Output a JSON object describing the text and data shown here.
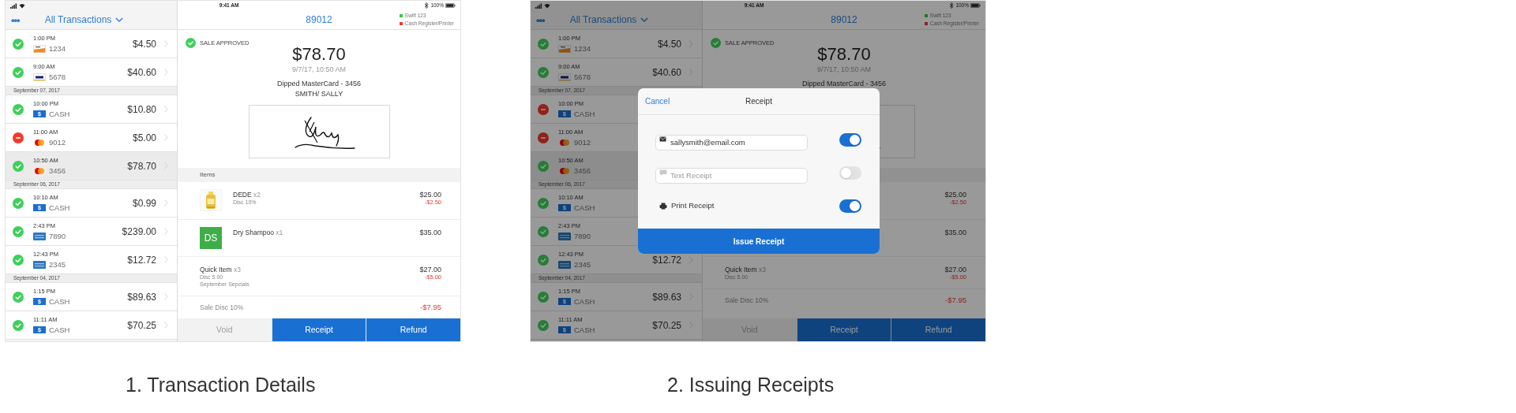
{
  "screens": [
    {
      "dimmed": false,
      "status_bar": {
        "time": "9:41 AM",
        "battery": "100%"
      },
      "list": {
        "menu": "•••",
        "title": "All Transactions",
        "entries": [
          {
            "kind": "transaction",
            "time": "1:00 PM",
            "payment": {
              "kind": "discover",
              "number": "1234"
            },
            "amount": "$4.50",
            "declined": false,
            "selected": false
          },
          {
            "kind": "transaction",
            "time": "9:00 AM",
            "payment": {
              "kind": "visa",
              "number": "5678"
            },
            "amount": "$40.60",
            "declined": false,
            "selected": false
          },
          {
            "kind": "date",
            "label": "September 07, 2017"
          },
          {
            "kind": "transaction",
            "time": "10:00 PM",
            "payment": {
              "kind": "cash",
              "badge": "$",
              "number": "CASH"
            },
            "amount": "$10.80",
            "declined": false,
            "selected": false
          },
          {
            "kind": "transaction",
            "time": "11:00 AM",
            "payment": {
              "kind": "mastercard",
              "number": "9012"
            },
            "amount": "$5.00",
            "declined": true,
            "selected": false
          },
          {
            "kind": "transaction",
            "time": "10:50 AM",
            "payment": {
              "kind": "mastercard",
              "number": "3456"
            },
            "amount": "$78.70",
            "declined": false,
            "selected": true
          },
          {
            "kind": "date",
            "label": "September 06, 2017"
          },
          {
            "kind": "transaction",
            "time": "10:10 AM",
            "payment": {
              "kind": "cash",
              "badge": "$",
              "number": "CASH"
            },
            "amount": "$0.99",
            "declined": false,
            "selected": false
          },
          {
            "kind": "transaction",
            "time": "2:43 PM",
            "payment": {
              "kind": "amex",
              "number": "7890"
            },
            "amount": "$239.00",
            "declined": false,
            "selected": false
          },
          {
            "kind": "transaction",
            "time": "12:43 PM",
            "payment": {
              "kind": "amex",
              "number": "2345"
            },
            "amount": "$12.72",
            "declined": false,
            "selected": false
          },
          {
            "kind": "date",
            "label": "September 04, 2017"
          },
          {
            "kind": "transaction",
            "time": "1:15 PM",
            "payment": {
              "kind": "cash",
              "badge": "$",
              "number": "CASH"
            },
            "amount": "$89.63",
            "declined": false,
            "selected": false
          },
          {
            "kind": "transaction",
            "time": "11:11 AM",
            "payment": {
              "kind": "cash",
              "badge": "$",
              "number": "CASH"
            },
            "amount": "$70.25",
            "declined": false,
            "selected": false
          }
        ]
      },
      "detail": {
        "title": "89012",
        "devices": [
          {
            "label": "Swift 123",
            "color": "#2ecc40"
          },
          {
            "label": "Cash Register/Printer",
            "color": "#e53935"
          }
        ],
        "result": "SALE APPROVED",
        "total": "$78.70",
        "date": "9/7/17, 10:50 AM",
        "card": "Dipped MasterCard - 3456",
        "holder": "SMITH/ SALLY",
        "items_header": "Items",
        "items": [
          {
            "thumb": {
              "kind": "picture"
            },
            "name": "DEDE",
            "qty": "x2",
            "notes": [
              "Disc 10%"
            ],
            "price": "$25.00",
            "discount": "-$2.50"
          },
          {
            "thumb": {
              "kind": "initials",
              "initials": "DS"
            },
            "name": "Dry Shampoo",
            "qty": "x1",
            "price": "$35.00"
          },
          {
            "name": "Quick Item",
            "qty": "x3",
            "notes": [
              "Disc 5.00",
              "September Sepcials"
            ],
            "price": "$27.00",
            "discount": "-$5.00"
          }
        ],
        "sale_discount": {
          "label": "Sale Disc 10%",
          "amount": "-$7.95"
        },
        "actions": [
          {
            "label": "Void",
            "disabled": true
          },
          {
            "label": "Receipt",
            "disabled": false
          },
          {
            "label": "Refund",
            "disabled": false
          }
        ]
      }
    },
    {
      "dimmed": true,
      "status_bar": {
        "time": "9:41 AM",
        "battery": "100%"
      },
      "list": {
        "menu": "•••",
        "title": "All Transactions",
        "entries": [
          {
            "kind": "transaction",
            "time": "1:00 PM",
            "payment": {
              "kind": "discover",
              "number": "1234"
            },
            "amount": "$4.50",
            "declined": false,
            "selected": false
          },
          {
            "kind": "transaction",
            "time": "9:00 AM",
            "payment": {
              "kind": "visa",
              "number": "5678"
            },
            "amount": "$40.60",
            "declined": false,
            "selected": false
          },
          {
            "kind": "date",
            "label": "September 07, 2017"
          },
          {
            "kind": "transaction",
            "time": "10:00 PM",
            "payment": {
              "kind": "cash",
              "badge": "$",
              "number": "CASH"
            },
            "declined": true,
            "selected": false
          },
          {
            "kind": "transaction",
            "time": "11:00 AM",
            "payment": {
              "kind": "mastercard",
              "number": "9012"
            },
            "declined": true,
            "selected": false
          },
          {
            "kind": "transaction",
            "time": "10:50 AM",
            "payment": {
              "kind": "mastercard",
              "number": "3456"
            },
            "declined": false,
            "selected": true
          },
          {
            "kind": "date",
            "label": "September 06, 2017"
          },
          {
            "kind": "transaction",
            "time": "10:10 AM",
            "payment": {
              "kind": "cash",
              "badge": "$",
              "number": "CASH"
            },
            "declined": false,
            "selected": false
          },
          {
            "kind": "transaction",
            "time": "2:43 PM",
            "payment": {
              "kind": "amex",
              "number": "7890"
            },
            "declined": false,
            "selected": false
          },
          {
            "kind": "transaction",
            "time": "12:43 PM",
            "payment": {
              "kind": "amex",
              "number": "2345"
            },
            "amount": "$12.72",
            "declined": false,
            "selected": false
          },
          {
            "kind": "date",
            "label": "September 04, 2017"
          },
          {
            "kind": "transaction",
            "time": "1:15 PM",
            "payment": {
              "kind": "cash",
              "badge": "$",
              "number": "CASH"
            },
            "amount": "$89.63",
            "declined": false,
            "selected": false
          },
          {
            "kind": "transaction",
            "time": "11:11 AM",
            "payment": {
              "kind": "cash",
              "badge": "$",
              "number": "CASH"
            },
            "amount": "$70.25",
            "declined": false,
            "selected": false
          }
        ]
      },
      "detail": {
        "title": "89012",
        "devices": [
          {
            "label": "Swift 123",
            "color": "#1c7a26"
          },
          {
            "label": "Cash Register/Printer",
            "color": "#892220"
          }
        ],
        "result": "SALE APPROVED",
        "total": "$78.70",
        "date": "9/7/17, 10:50 AM",
        "card": "Dipped MasterCard - 3456",
        "items": [
          {
            "price": "$25.00",
            "discount": "-$2.50"
          },
          {
            "price": "$35.00"
          },
          {
            "name": "Quick Item",
            "qty": "x3",
            "notes": [
              "Disc 5.00"
            ],
            "price": "$27.00",
            "discount": "-$5.00"
          }
        ],
        "sale_discount": {
          "label": "Sale Disc 10%",
          "amount": "-$7.95"
        },
        "actions": [
          {
            "label": "Void",
            "disabled": true
          },
          {
            "label": "Receipt",
            "disabled": false
          },
          {
            "label": "Refund",
            "disabled": false
          }
        ]
      },
      "dialog": {
        "cancel": "Cancel",
        "title": "Receipt",
        "options": [
          {
            "kind": "email",
            "value": "sallysmith@email.com",
            "on": true
          },
          {
            "kind": "sms",
            "placeholder": "Text Receipt",
            "on": false
          },
          {
            "kind": "print",
            "label": "Print Receipt",
            "on": true
          }
        ],
        "submit": "Issue Receipt"
      }
    }
  ],
  "captions": [
    "1. Transaction Details",
    "2. Issuing Receipts"
  ]
}
